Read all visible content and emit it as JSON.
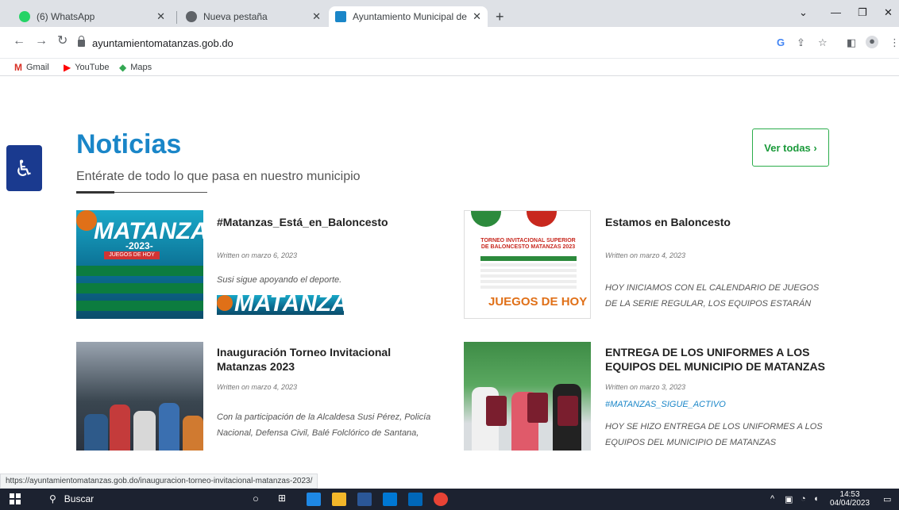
{
  "browser": {
    "tabs": [
      {
        "title": "(6) WhatsApp",
        "favicon_color": "#25d366"
      },
      {
        "title": "Nueva pestaña",
        "favicon_color": "#5f6368"
      },
      {
        "title": "Ayuntamiento Municipal de Mata",
        "favicon_color": "#1a86c8",
        "active": true
      }
    ],
    "url": "ayuntamientomatanzas.gob.do",
    "bookmarks": [
      {
        "label": "Gmail",
        "icon": "gmail-icon"
      },
      {
        "label": "YouTube",
        "icon": "youtube-icon"
      },
      {
        "label": "Maps",
        "icon": "maps-icon"
      }
    ]
  },
  "page": {
    "title": "Noticias",
    "subtitle": "Entérate de todo lo que pasa en nuestro municipio",
    "view_all": "Ver todas ›",
    "accent_color": "#1a86c8",
    "button_color": "#2bad4b",
    "articles": [
      {
        "title": "#Matanzas_Está_en_Baloncesto",
        "date": "Written on marzo 6, 2023",
        "excerpt": "Susi sigue apoyando el deporte.",
        "thumb_text": "MATANZAS",
        "thumb_year": "-2023-",
        "thumb_banner": "JUEGOS DE HOY"
      },
      {
        "title": "Estamos en Baloncesto",
        "date": "Written on marzo 4, 2023",
        "excerpt": "HOY INICIAMOS CON EL CALENDARIO DE JUEGOS DE LA SERIE REGULAR, LOS EQUIPOS ESTARÁN DIVIDIDOS POR",
        "thumb_title": "TORNEO INVITACIONAL SUPERIOR DE BALONCESTO MATANZAS 2023",
        "thumb_banner": "JUEGOS DE HOY"
      },
      {
        "title": "Inauguración Torneo Invitacional Matanzas 2023",
        "date": "Written on marzo 4, 2023",
        "excerpt": "Con la participación de la Alcaldesa Susi Pérez, Policía Nacional, Defensa Civil, Balé Folclórico de Santana,"
      },
      {
        "title": "ENTREGA DE LOS UNIFORMES A LOS EQUIPOS DEL MUNICIPIO DE MATANZAS",
        "date": "Written on marzo 3, 2023",
        "tag": "#MATANZAS_SIGUE_ACTIVO",
        "excerpt": "HOY SE HIZO ENTREGA DE LOS UNIFORMES A LOS EQUIPOS DEL MUNICIPIO DE MATANZAS"
      }
    ]
  },
  "status_url": "https://ayuntamientomatanzas.gob.do/inauguracion-torneo-invitacional-matanzas-2023/",
  "taskbar": {
    "search": "Buscar",
    "time": "14:53",
    "date": "04/04/2023"
  }
}
